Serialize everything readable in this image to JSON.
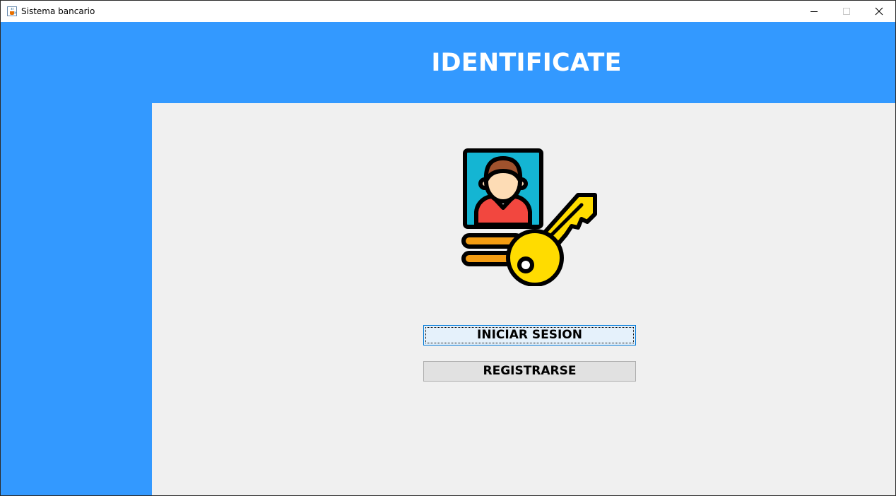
{
  "window": {
    "title": "Sistema bancario",
    "app_icon": "java-cup-icon",
    "controls": [
      "minimize-icon",
      "maximize-icon",
      "close-icon"
    ]
  },
  "header": {
    "title": "IDENTIFICATE"
  },
  "illustration": {
    "icon": "id-card-key-icon"
  },
  "buttons": {
    "login_label": "INICIAR SESION",
    "register_label": "REGISTRARSE"
  },
  "colors": {
    "accent": "#3399ff",
    "panel": "#f0f0f0",
    "button_face": "#e1e1e1",
    "focus_border": "#0078d7",
    "key_yellow": "#ffdc00",
    "card_cyan": "#14b5d3",
    "shirt_red": "#f2473f",
    "hair_brown": "#a0522d",
    "skin": "#fddcb5",
    "stripe_orange": "#f39c12"
  }
}
